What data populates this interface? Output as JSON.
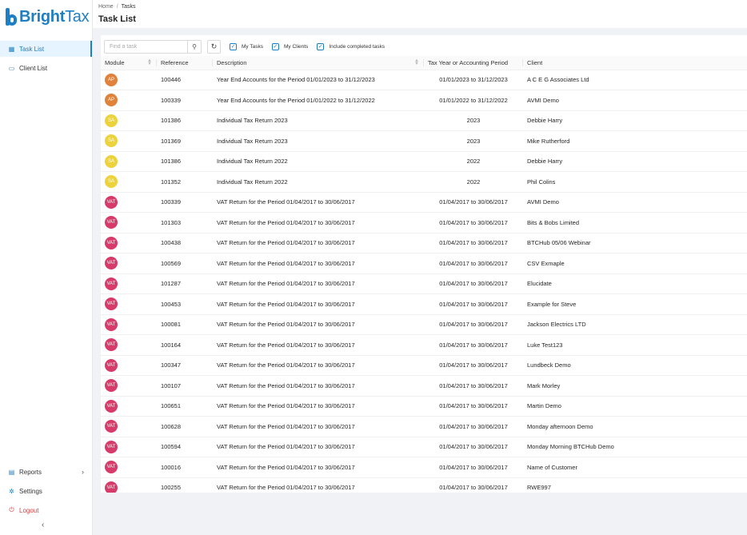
{
  "brand": {
    "name_bold": "Bright",
    "name_thin": "Tax"
  },
  "sidebar": {
    "items": [
      {
        "label": "Task List",
        "icon": "task-list-icon"
      },
      {
        "label": "Client List",
        "icon": "client-list-icon"
      }
    ],
    "bottom": [
      {
        "label": "Reports",
        "icon": "reports-icon"
      },
      {
        "label": "Settings",
        "icon": "settings-gear-icon"
      },
      {
        "label": "Logout",
        "icon": "logout-icon"
      }
    ],
    "collapse_glyph": "‹"
  },
  "header": {
    "breadcrumb": [
      "Home",
      "Tasks"
    ],
    "title": "Task List"
  },
  "toolbar": {
    "search_placeholder": "Find a task",
    "checkboxes": [
      "My Tasks",
      "My Clients",
      "Include completed tasks"
    ]
  },
  "table": {
    "columns": [
      "Module",
      "Reference",
      "Description",
      "Tax Year or Accounting Period",
      "Client"
    ],
    "rows": [
      {
        "module": "AP",
        "color": "#e0823a",
        "ref": "100446",
        "desc": "Year End Accounts for the Period 01/01/2023 to 31/12/2023",
        "period": "01/01/2023 to 31/12/2023",
        "client": "A C E G Associates Ltd"
      },
      {
        "module": "AP",
        "color": "#e0823a",
        "ref": "100339",
        "desc": "Year End Accounts for the Period 01/01/2022 to 31/12/2022",
        "period": "01/01/2022 to 31/12/2022",
        "client": "AVMI Demo"
      },
      {
        "module": "SA",
        "color": "#ecd33d",
        "ref": "101386",
        "desc": "Individual Tax Return 2023",
        "period": "2023",
        "client": "Debbie Harry"
      },
      {
        "module": "SA",
        "color": "#ecd33d",
        "ref": "101369",
        "desc": "Individual Tax Return 2023",
        "period": "2023",
        "client": "Mike Rutherford"
      },
      {
        "module": "SA",
        "color": "#ecd33d",
        "ref": "101386",
        "desc": "Individual Tax Return 2022",
        "period": "2022",
        "client": "Debbie Harry"
      },
      {
        "module": "SA",
        "color": "#ecd33d",
        "ref": "101352",
        "desc": "Individual Tax Return 2022",
        "period": "2022",
        "client": "Phil Colins"
      },
      {
        "module": "VAT",
        "color": "#d63b6a",
        "ref": "100339",
        "desc": "VAT Return for the Period 01/04/2017 to 30/06/2017",
        "period": "01/04/2017 to 30/06/2017",
        "client": "AVMI Demo"
      },
      {
        "module": "VAT",
        "color": "#d63b6a",
        "ref": "101303",
        "desc": "VAT Return for the Period 01/04/2017 to 30/06/2017",
        "period": "01/04/2017 to 30/06/2017",
        "client": "Bits & Bobs Limited"
      },
      {
        "module": "VAT",
        "color": "#d63b6a",
        "ref": "100438",
        "desc": "VAT Return for the Period 01/04/2017 to 30/06/2017",
        "period": "01/04/2017 to 30/06/2017",
        "client": "BTCHub 05/06 Webinar"
      },
      {
        "module": "VAT",
        "color": "#d63b6a",
        "ref": "100569",
        "desc": "VAT Return for the Period 01/04/2017 to 30/06/2017",
        "period": "01/04/2017 to 30/06/2017",
        "client": "CSV Exmaple"
      },
      {
        "module": "VAT",
        "color": "#d63b6a",
        "ref": "101287",
        "desc": "VAT Return for the Period 01/04/2017 to 30/06/2017",
        "period": "01/04/2017 to 30/06/2017",
        "client": "Elucidate"
      },
      {
        "module": "VAT",
        "color": "#d63b6a",
        "ref": "100453",
        "desc": "VAT Return for the Period 01/04/2017 to 30/06/2017",
        "period": "01/04/2017 to 30/06/2017",
        "client": "Example for Steve"
      },
      {
        "module": "VAT",
        "color": "#d63b6a",
        "ref": "100081",
        "desc": "VAT Return for the Period 01/04/2017 to 30/06/2017",
        "period": "01/04/2017 to 30/06/2017",
        "client": "Jackson Electrics LTD"
      },
      {
        "module": "VAT",
        "color": "#d63b6a",
        "ref": "100164",
        "desc": "VAT Return for the Period 01/04/2017 to 30/06/2017",
        "period": "01/04/2017 to 30/06/2017",
        "client": "Luke Test123"
      },
      {
        "module": "VAT",
        "color": "#d63b6a",
        "ref": "100347",
        "desc": "VAT Return for the Period 01/04/2017 to 30/06/2017",
        "period": "01/04/2017 to 30/06/2017",
        "client": "Lundbeck Demo"
      },
      {
        "module": "VAT",
        "color": "#d63b6a",
        "ref": "100107",
        "desc": "VAT Return for the Period 01/04/2017 to 30/06/2017",
        "period": "01/04/2017 to 30/06/2017",
        "client": "Mark Morley"
      },
      {
        "module": "VAT",
        "color": "#d63b6a",
        "ref": "100651",
        "desc": "VAT Return for the Period 01/04/2017 to 30/06/2017",
        "period": "01/04/2017 to 30/06/2017",
        "client": "Martin Demo"
      },
      {
        "module": "VAT",
        "color": "#d63b6a",
        "ref": "100628",
        "desc": "VAT Return for the Period 01/04/2017 to 30/06/2017",
        "period": "01/04/2017 to 30/06/2017",
        "client": "Monday afternoon Demo"
      },
      {
        "module": "VAT",
        "color": "#d63b6a",
        "ref": "100594",
        "desc": "VAT Return for the Period 01/04/2017 to 30/06/2017",
        "period": "01/04/2017 to 30/06/2017",
        "client": "Monday Morning BTCHub Demo"
      },
      {
        "module": "VAT",
        "color": "#d63b6a",
        "ref": "100016",
        "desc": "VAT Return for the Period 01/04/2017 to 30/06/2017",
        "period": "01/04/2017 to 30/06/2017",
        "client": "Name of Customer"
      },
      {
        "module": "VAT",
        "color": "#d63b6a",
        "ref": "100255",
        "desc": "VAT Return for the Period 01/04/2017 to 30/06/2017",
        "period": "01/04/2017 to 30/06/2017",
        "client": "RWE997"
      }
    ]
  },
  "colors": {
    "accent": "#1d7fc4",
    "ap": "#e0823a",
    "sa": "#ecd33d",
    "vat": "#d63b6a",
    "logout": "#d93f3f"
  }
}
